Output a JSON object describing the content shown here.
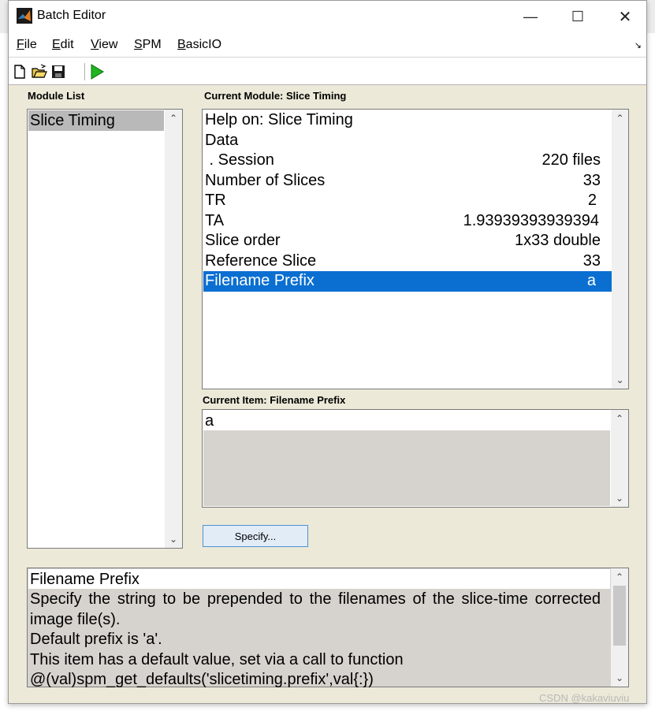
{
  "window": {
    "title": "Batch Editor",
    "minimize_glyph": "—",
    "maximize_glyph": "☐",
    "close_glyph": "✕"
  },
  "menu": {
    "items": [
      {
        "accel": "F",
        "rest": "ile"
      },
      {
        "accel": "E",
        "rest": "dit"
      },
      {
        "accel": "V",
        "rest": "iew"
      },
      {
        "accel": "S",
        "rest": "PM"
      },
      {
        "accel": "B",
        "rest": "asicIO"
      }
    ]
  },
  "toolbar": {
    "icons": [
      "new-file-icon",
      "open-folder-icon",
      "save-icon",
      "run-icon"
    ]
  },
  "module_list": {
    "label": "Module List",
    "items": [
      "Slice Timing"
    ]
  },
  "current_module": {
    "label": "Current Module: Slice Timing",
    "rows": [
      {
        "name": "Help on: Slice Timing",
        "value": ""
      },
      {
        "name": "Data",
        "value": ""
      },
      {
        "name": " . Session",
        "value": "220 files"
      },
      {
        "name": "Number of Slices",
        "value": "33"
      },
      {
        "name": "TR",
        "value": "2"
      },
      {
        "name": "TA",
        "value": "1.93939393939394"
      },
      {
        "name": "Slice order",
        "value": "1x33 double"
      },
      {
        "name": "Reference Slice",
        "value": "33"
      },
      {
        "name": "Filename Prefix",
        "value": "a"
      }
    ]
  },
  "current_item": {
    "label": "Current Item: Filename Prefix",
    "value": "a"
  },
  "specify_button": {
    "label": "Specify..."
  },
  "help": {
    "title": "Filename Prefix",
    "line1": "Specify the string to be prepended to the filenames of the slice-time corrected",
    "line2": "image file(s).",
    "line3": "Default prefix is 'a'.",
    "line4": "This item has a default value, set via a call to function",
    "line5": "@(val)spm_get_defaults('slicetiming.prefix',val{:})"
  },
  "watermark": "CSDN @kakaviuviu",
  "colors": {
    "selection": "#0a6fd1",
    "panel_bg": "#ece9d8",
    "run_green": "#1fb51f"
  }
}
